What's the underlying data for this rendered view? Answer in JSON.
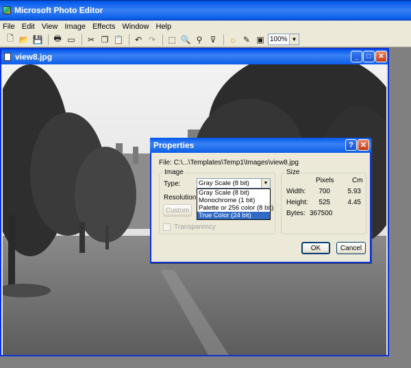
{
  "app": {
    "title": "Microsoft Photo Editor"
  },
  "menu": [
    "File",
    "Edit",
    "View",
    "Image",
    "Effects",
    "Window",
    "Help"
  ],
  "toolbar": {
    "icons": [
      "new-icon",
      "open-icon",
      "save-icon",
      "print-icon",
      "scan-icon",
      "cut-icon",
      "copy-icon",
      "paste-icon",
      "undo-icon",
      "redo-icon",
      "select-icon",
      "zoom-icon",
      "pin-icon",
      "smudge-icon",
      "sun-icon",
      "pencil-icon",
      "frame-icon"
    ],
    "zoom": "100%"
  },
  "document": {
    "title": "view8.jpg"
  },
  "dialog": {
    "title": "Properties",
    "file_label": "File:",
    "file_path": "C:\\...\\Templates\\Temp1\\Images\\view8.jpg",
    "image_group": "Image",
    "type_label": "Type:",
    "type_value": "Gray Scale (8 bit)",
    "type_options": [
      "Gray Scale (8 bit)",
      "Monochrome (1 bit)",
      "Palette or 256 color (8 bit)",
      "True Color (24 bit)"
    ],
    "type_highlighted": "True Color (24 bit)",
    "resolution_label": "Resolution",
    "custom_button": "Custom",
    "transparency_label": "Transparency",
    "size_group": "Size",
    "size": {
      "pixels_header": "Pixels",
      "cm_header": "Cm",
      "width_label": "Width:",
      "width_px": "700",
      "width_cm": "5.93",
      "height_label": "Height:",
      "height_px": "525",
      "height_cm": "4.45",
      "bytes_label": "Bytes:",
      "bytes": "367500"
    },
    "ok": "OK",
    "cancel": "Cancel"
  }
}
